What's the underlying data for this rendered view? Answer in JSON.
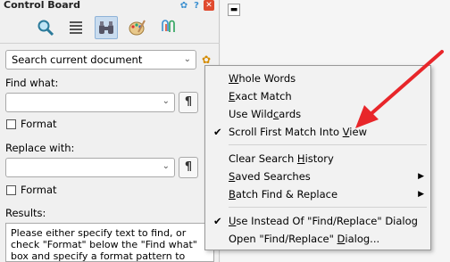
{
  "panel": {
    "title": "Control Board",
    "search_scope": "Search current document",
    "find_label": "Find what:",
    "replace_label": "Replace with:",
    "format_label": "Format",
    "format_label2": "Format",
    "pilcrow": "¶",
    "results_label": "Results:",
    "results_text": "Please either specify text to find, or check \"Format\" below the \"Find what\" box and specify a format pattern to search for."
  },
  "menu": {
    "items": [
      {
        "pre": "",
        "u": "W",
        "post": "hole Words"
      },
      {
        "pre": "",
        "u": "E",
        "post": "xact Match"
      },
      {
        "pre": "Use Wild",
        "u": "c",
        "post": "ards"
      },
      {
        "pre": "Scroll First Match Into ",
        "u": "V",
        "post": "iew"
      },
      {
        "pre": "Clear Search ",
        "u": "H",
        "post": "istory"
      },
      {
        "pre": "",
        "u": "S",
        "post": "aved Searches"
      },
      {
        "pre": "",
        "u": "B",
        "post": "atch Find & Replace"
      },
      {
        "pre": "",
        "u": "U",
        "post": "se Instead Of \"Find/Replace\" Dialog"
      },
      {
        "pre": "Open \"Find/Replace\" ",
        "u": "D",
        "post": "ialog..."
      }
    ]
  },
  "colors": {
    "accent_blue": "#3a8fd0",
    "close_red": "#e04a2f",
    "arrow_red": "#e8262a"
  },
  "icons": [
    "gear-icon",
    "help-icon",
    "close-icon",
    "magnifier-icon",
    "list-icon",
    "binoculars-icon",
    "palette-icon",
    "paperclip-icon"
  ]
}
